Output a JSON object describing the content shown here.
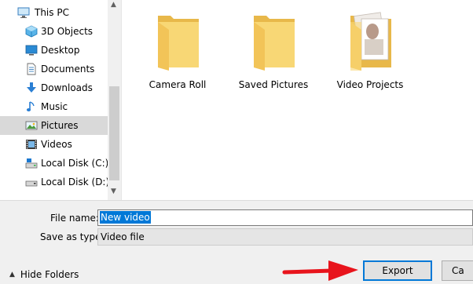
{
  "nav": {
    "items": [
      {
        "label": "This PC",
        "icon": "this-pc-icon"
      },
      {
        "label": "3D Objects",
        "icon": "3d-objects-icon"
      },
      {
        "label": "Desktop",
        "icon": "desktop-icon"
      },
      {
        "label": "Documents",
        "icon": "documents-icon"
      },
      {
        "label": "Downloads",
        "icon": "downloads-icon"
      },
      {
        "label": "Music",
        "icon": "music-icon"
      },
      {
        "label": "Pictures",
        "icon": "pictures-icon",
        "selected": true
      },
      {
        "label": "Videos",
        "icon": "videos-icon"
      },
      {
        "label": "Local Disk (C:)",
        "icon": "drive-c-icon"
      },
      {
        "label": "Local Disk (D:)",
        "icon": "drive-d-icon"
      }
    ]
  },
  "content": {
    "folders": [
      {
        "label": "Camera Roll",
        "icon": "folder-icon"
      },
      {
        "label": "Saved Pictures",
        "icon": "folder-icon"
      },
      {
        "label": "Video Projects",
        "icon": "folder-with-images-icon"
      }
    ]
  },
  "form": {
    "filename_label": "File name:",
    "filename_value": "New video",
    "savetype_label": "Save as type:",
    "savetype_value": "Video file"
  },
  "footer": {
    "hide_folders_label": "Hide Folders",
    "export_label": "Export",
    "cancel_label": "Ca"
  },
  "colors": {
    "selection": "#0078d7",
    "folder": "#f8d775",
    "arrow": "#e8141c"
  }
}
